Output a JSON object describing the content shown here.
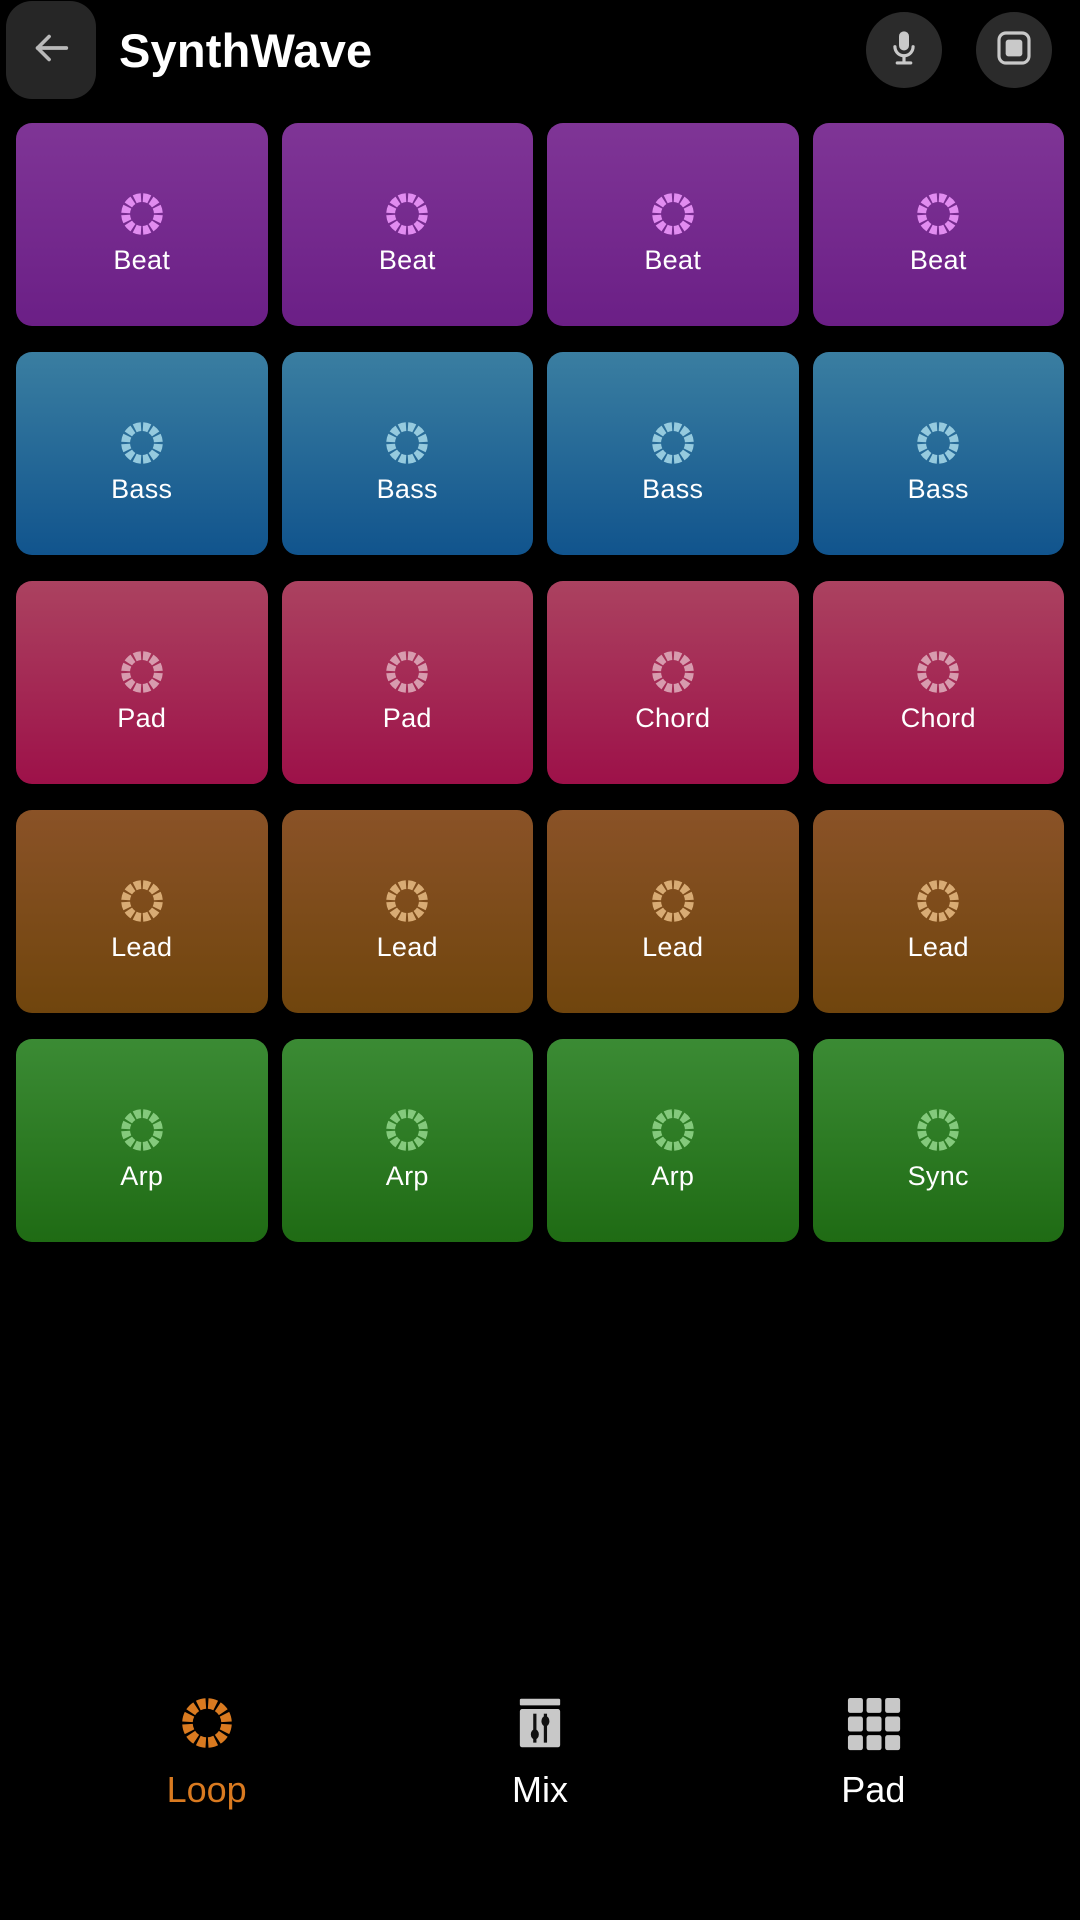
{
  "header": {
    "back_icon": "arrow-left-icon",
    "title": "SynthWave",
    "mic_icon": "microphone-icon",
    "stop_icon": "stop-square-icon"
  },
  "grid": {
    "columns": 4,
    "rows": 5,
    "pads": [
      {
        "label": "Beat",
        "color_class": "c-purple",
        "icon": "loop-ring-icon",
        "icon_color": "#e18cf0",
        "gradient_top": "#7f3596",
        "gradient_bottom": "#6b1f86"
      },
      {
        "label": "Beat",
        "color_class": "c-purple",
        "icon": "loop-ring-icon",
        "icon_color": "#e18cf0",
        "gradient_top": "#7f3596",
        "gradient_bottom": "#6b1f86"
      },
      {
        "label": "Beat",
        "color_class": "c-purple",
        "icon": "loop-ring-icon",
        "icon_color": "#e18cf0",
        "gradient_top": "#7f3596",
        "gradient_bottom": "#6b1f86"
      },
      {
        "label": "Beat",
        "color_class": "c-purple",
        "icon": "loop-ring-icon",
        "icon_color": "#e18cf0",
        "gradient_top": "#7f3596",
        "gradient_bottom": "#6b1f86"
      },
      {
        "label": "Bass",
        "color_class": "c-blue",
        "icon": "loop-ring-icon",
        "icon_color": "#95cade",
        "gradient_top": "#3a7ea1",
        "gradient_bottom": "#11548d"
      },
      {
        "label": "Bass",
        "color_class": "c-blue",
        "icon": "loop-ring-icon",
        "icon_color": "#95cade",
        "gradient_top": "#3a7ea1",
        "gradient_bottom": "#11548d"
      },
      {
        "label": "Bass",
        "color_class": "c-blue",
        "icon": "loop-ring-icon",
        "icon_color": "#95cade",
        "gradient_top": "#3a7ea1",
        "gradient_bottom": "#11548d"
      },
      {
        "label": "Bass",
        "color_class": "c-blue",
        "icon": "loop-ring-icon",
        "icon_color": "#95cade",
        "gradient_top": "#3a7ea1",
        "gradient_bottom": "#11548d"
      },
      {
        "label": "Pad",
        "color_class": "c-crimson",
        "icon": "loop-ring-icon",
        "icon_color": "#d79bae",
        "gradient_top": "#ab4260",
        "gradient_bottom": "#9d1149"
      },
      {
        "label": "Pad",
        "color_class": "c-crimson",
        "icon": "loop-ring-icon",
        "icon_color": "#d79bae",
        "gradient_top": "#ab4260",
        "gradient_bottom": "#9d1149"
      },
      {
        "label": "Chord",
        "color_class": "c-crimson",
        "icon": "loop-ring-icon",
        "icon_color": "#d79bae",
        "gradient_top": "#ab4260",
        "gradient_bottom": "#9d1149"
      },
      {
        "label": "Chord",
        "color_class": "c-crimson",
        "icon": "loop-ring-icon",
        "icon_color": "#d79bae",
        "gradient_top": "#ab4260",
        "gradient_bottom": "#9d1149"
      },
      {
        "label": "Lead",
        "color_class": "c-brown",
        "icon": "loop-ring-icon",
        "icon_color": "#d8ab74",
        "gradient_top": "#8a5227",
        "gradient_bottom": "#70450d"
      },
      {
        "label": "Lead",
        "color_class": "c-brown",
        "icon": "loop-ring-icon",
        "icon_color": "#d8ab74",
        "gradient_top": "#8a5227",
        "gradient_bottom": "#70450d"
      },
      {
        "label": "Lead",
        "color_class": "c-brown",
        "icon": "loop-ring-icon",
        "icon_color": "#d8ab74",
        "gradient_top": "#8a5227",
        "gradient_bottom": "#70450d"
      },
      {
        "label": "Lead",
        "color_class": "c-brown",
        "icon": "loop-ring-icon",
        "icon_color": "#d8ab74",
        "gradient_top": "#8a5227",
        "gradient_bottom": "#70450d"
      },
      {
        "label": "Arp",
        "color_class": "c-green",
        "icon": "loop-ring-icon",
        "icon_color": "#84c97c",
        "gradient_top": "#3b8b34",
        "gradient_bottom": "#1f6b14"
      },
      {
        "label": "Arp",
        "color_class": "c-green",
        "icon": "loop-ring-icon",
        "icon_color": "#84c97c",
        "gradient_top": "#3b8b34",
        "gradient_bottom": "#1f6b14"
      },
      {
        "label": "Arp",
        "color_class": "c-green",
        "icon": "loop-ring-icon",
        "icon_color": "#84c97c",
        "gradient_top": "#3b8b34",
        "gradient_bottom": "#1f6b14"
      },
      {
        "label": "Sync",
        "color_class": "c-green",
        "icon": "loop-ring-icon",
        "icon_color": "#84c97c",
        "gradient_top": "#3b8b34",
        "gradient_bottom": "#1f6b14"
      }
    ]
  },
  "bottom_nav": {
    "active_color": "#d97a20",
    "inactive_color": "#ffffff",
    "items": [
      {
        "label": "Loop",
        "icon": "loop-ring-icon",
        "active": true,
        "icon_color": "#d97a20"
      },
      {
        "label": "Mix",
        "icon": "mixer-faders-icon",
        "active": false,
        "icon_color": "#c8c8c8"
      },
      {
        "label": "Pad",
        "icon": "grid-3x3-icon",
        "active": false,
        "icon_color": "#c8c8c8"
      }
    ]
  }
}
